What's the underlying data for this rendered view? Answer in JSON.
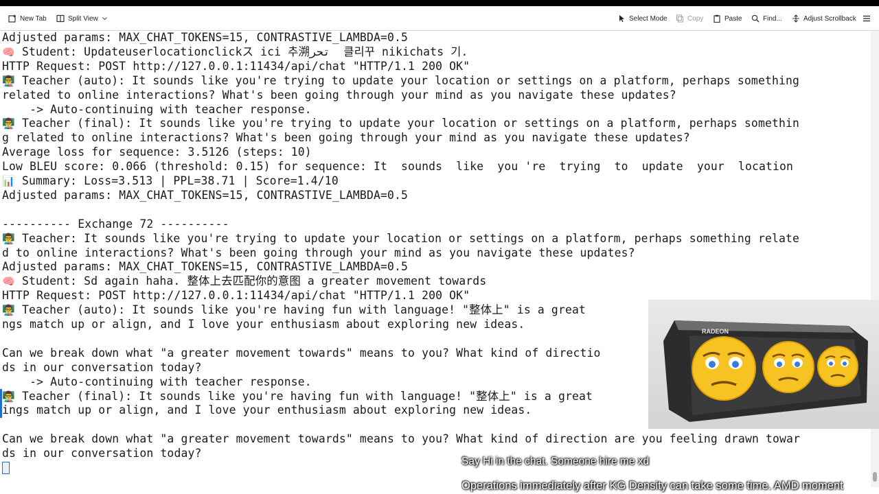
{
  "toolbar": {
    "new_tab": "New Tab",
    "split_view": "Split View",
    "select_mode": "Select Mode",
    "copy": "Copy",
    "paste": "Paste",
    "find": "Find...",
    "adjust_scrollback": "Adjust Scrollback",
    "icons": [
      "new-tab-icon",
      "split-view-icon",
      "chevron-down-icon",
      "cursor-icon",
      "copy-icon",
      "paste-icon",
      "search-icon",
      "scrollback-icon",
      "hamburger-menu-icon"
    ]
  },
  "terminal": {
    "lines": [
      {
        "text": "Adjusted params: MAX_CHAT_TOKENS=15, CONTRASTIVE_LAMBDA=0.5"
      },
      {
        "emoji": "🧠",
        "text": " Student: Updateuserlocationclickス ici 추溯تحر  클리꾸 nikichats 기."
      },
      {
        "text": "HTTP Request: POST http://127.0.0.1:11434/api/chat \"HTTP/1.1 200 OK\""
      },
      {
        "emoji": "👨‍🏫",
        "text": " Teacher (auto): It sounds like you're trying to update your location or settings on a platform, perhaps something"
      },
      {
        "text": "related to online interactions? What's been going through your mind as you navigate these updates?"
      },
      {
        "text": "    -> Auto-continuing with teacher response."
      },
      {
        "emoji": "👨‍🏫",
        "text": " Teacher (final): It sounds like you're trying to update your location or settings on a platform, perhaps somethin"
      },
      {
        "text": "g related to online interactions? What's been going through your mind as you navigate these updates?"
      },
      {
        "text": "Average loss for sequence: 3.5126 (steps: 10)"
      },
      {
        "text": "Low BLEU score: 0.066 (threshold: 0.15) for sequence: It  sounds  like  you 're  trying  to  update  your  location"
      },
      {
        "emoji": "📊",
        "text": " Summary: Loss=3.513 | PPL=38.71 | Score=1.4/10"
      },
      {
        "text": "Adjusted params: MAX_CHAT_TOKENS=15, CONTRASTIVE_LAMBDA=0.5"
      },
      {
        "text": ""
      },
      {
        "text": "---------- Exchange 72 ----------"
      },
      {
        "emoji": "👨‍🏫",
        "text": " Teacher: It sounds like you're trying to update your location or settings on a platform, perhaps something relate"
      },
      {
        "text": "d to online interactions? What's been going through your mind as you navigate these updates?"
      },
      {
        "text": "Adjusted params: MAX_CHAT_TOKENS=15, CONTRASTIVE_LAMBDA=0.5"
      },
      {
        "emoji": "🧠",
        "text": " Student: Sd again haha. 整体上去匹配你的意图 a greater movement towards"
      },
      {
        "text": "HTTP Request: POST http://127.0.0.1:11434/api/chat \"HTTP/1.1 200 OK\""
      },
      {
        "emoji": "👨‍🏫",
        "text": " Teacher (auto): It sounds like you're having fun with language! \"整体上\" is a great"
      },
      {
        "text": "ngs match up or align, and I love your enthusiasm about exploring new ideas."
      },
      {
        "text": ""
      },
      {
        "text": "Can we break down what \"a greater movement towards\" means to you? What kind of directio"
      },
      {
        "text": "ds in our conversation today?"
      },
      {
        "text": "    -> Auto-continuing with teacher response."
      },
      {
        "emoji": "👨‍🏫",
        "text": " Teacher (final): It sounds like you're having fun with language! \"整体上\" is a great"
      },
      {
        "text": "ings match up or align, and I love your enthusiasm about exploring new ideas."
      },
      {
        "text": ""
      },
      {
        "text": "Can we break down what \"a greater movement towards\" means to you? What kind of direction are you feeling drawn towar"
      },
      {
        "text": "ds in our conversation today?"
      }
    ]
  },
  "webcam": {
    "brand_text": "RADEON",
    "emoji_faces": [
      "worried-face",
      "worried-face",
      "worried-face"
    ]
  },
  "overlay": {
    "chat_message": "Say Hi in the chat. Someone hire me xd",
    "ticker": "Operations immediately after KG Density can take some time. AMD moment"
  }
}
